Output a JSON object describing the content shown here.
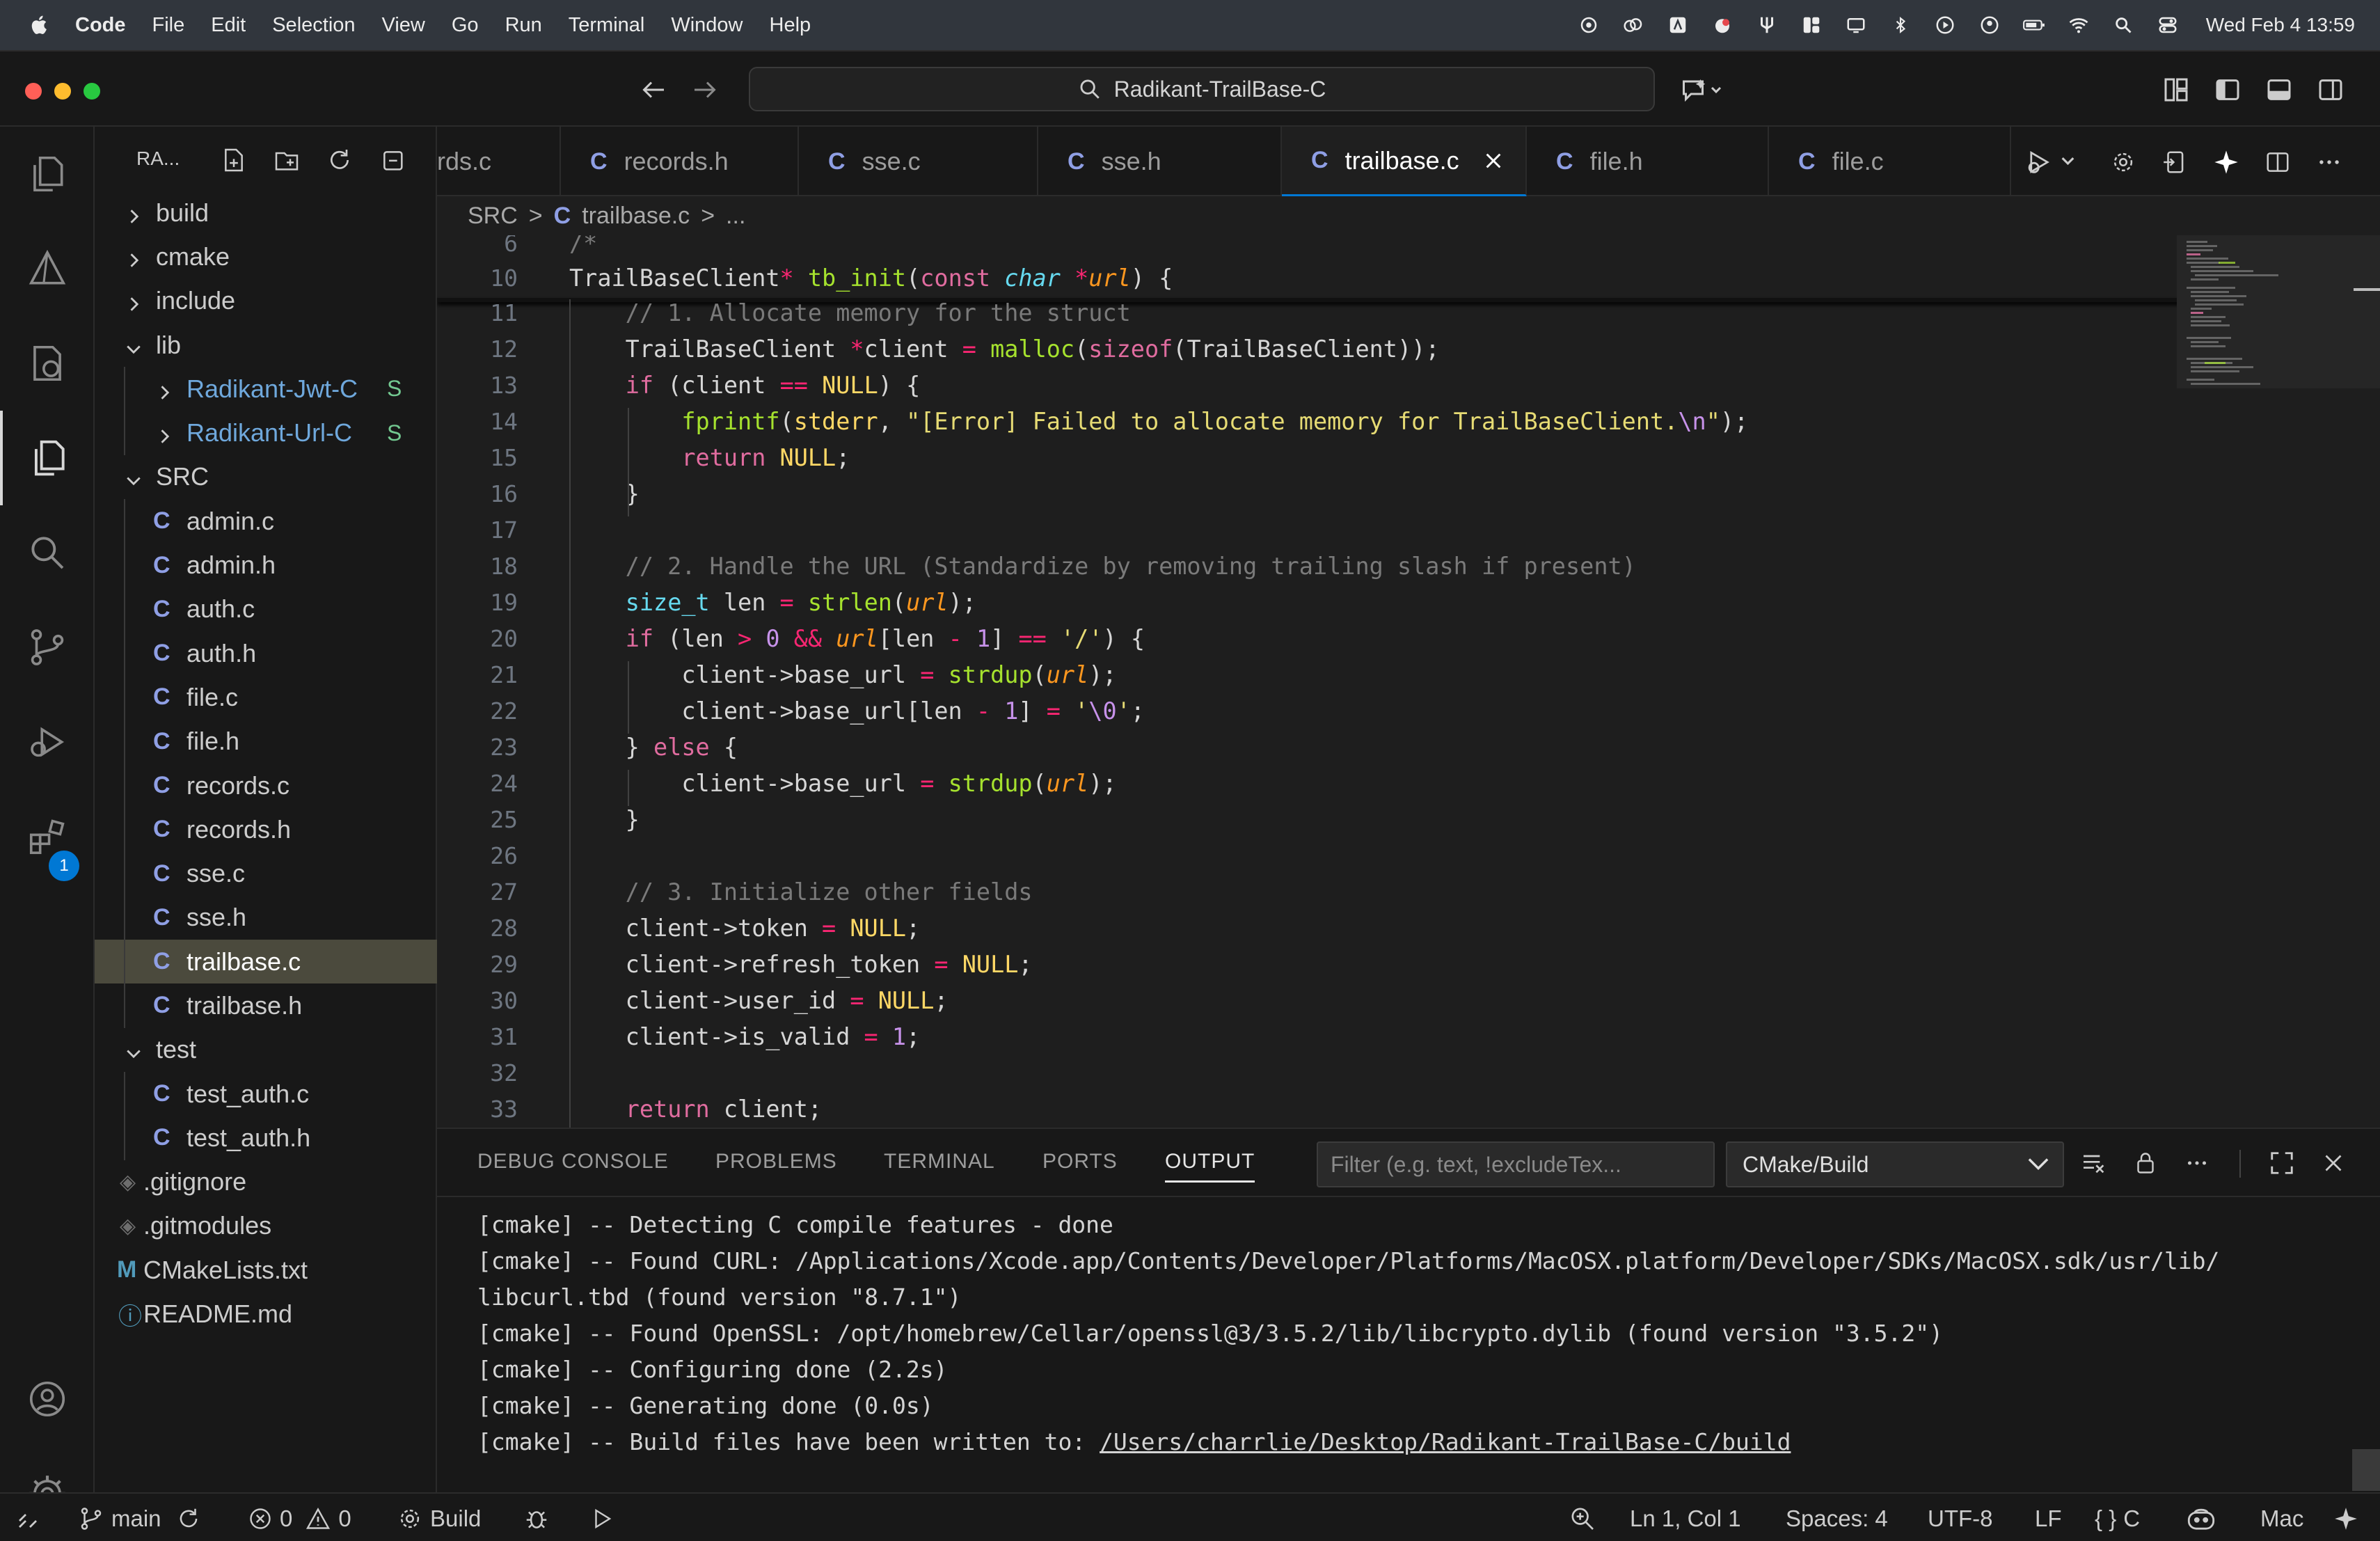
{
  "menubar": {
    "app": "Code",
    "items": [
      "File",
      "Edit",
      "Selection",
      "View",
      "Go",
      "Run",
      "Terminal",
      "Window",
      "Help"
    ],
    "clock": "Wed Feb 4  13:59"
  },
  "titlebar": {
    "search_text": "Radikant-TrailBase-C"
  },
  "sidebar": {
    "header": "RA...",
    "tree": [
      {
        "label": "build",
        "kind": "folder",
        "open": false,
        "depth": 0
      },
      {
        "label": "cmake",
        "kind": "folder",
        "open": false,
        "depth": 0
      },
      {
        "label": "include",
        "kind": "folder",
        "open": false,
        "depth": 0
      },
      {
        "label": "lib",
        "kind": "folder",
        "open": true,
        "depth": 0
      },
      {
        "label": "Radikant-Jwt-C",
        "kind": "submodule",
        "open": false,
        "depth": 1,
        "status": "S"
      },
      {
        "label": "Radikant-Url-C",
        "kind": "submodule",
        "open": false,
        "depth": 1,
        "status": "S"
      },
      {
        "label": "SRC",
        "kind": "folder",
        "open": true,
        "depth": 0
      },
      {
        "label": "admin.c",
        "kind": "c",
        "depth": 1
      },
      {
        "label": "admin.h",
        "kind": "c",
        "depth": 1
      },
      {
        "label": "auth.c",
        "kind": "c",
        "depth": 1
      },
      {
        "label": "auth.h",
        "kind": "c",
        "depth": 1
      },
      {
        "label": "file.c",
        "kind": "c",
        "depth": 1
      },
      {
        "label": "file.h",
        "kind": "c",
        "depth": 1
      },
      {
        "label": "records.c",
        "kind": "c",
        "depth": 1
      },
      {
        "label": "records.h",
        "kind": "c",
        "depth": 1
      },
      {
        "label": "sse.c",
        "kind": "c",
        "depth": 1
      },
      {
        "label": "sse.h",
        "kind": "c",
        "depth": 1
      },
      {
        "label": "trailbase.c",
        "kind": "c",
        "depth": 1,
        "selected": true
      },
      {
        "label": "trailbase.h",
        "kind": "c",
        "depth": 1
      },
      {
        "label": "test",
        "kind": "folder",
        "open": true,
        "depth": 0
      },
      {
        "label": "test_auth.c",
        "kind": "c",
        "depth": 1
      },
      {
        "label": "test_auth.h",
        "kind": "c",
        "depth": 1
      },
      {
        "label": ".gitignore",
        "kind": "git",
        "depth": 0
      },
      {
        "label": ".gitmodules",
        "kind": "git",
        "depth": 0
      },
      {
        "label": "CMakeLists.txt",
        "kind": "cmake",
        "depth": 0
      },
      {
        "label": "README.md",
        "kind": "info",
        "depth": 0
      }
    ]
  },
  "activitybar": {
    "extensions_badge": "1"
  },
  "tabs": [
    {
      "label": "rds.c",
      "icon": false
    },
    {
      "label": "records.h",
      "icon": true
    },
    {
      "label": "sse.c",
      "icon": true
    },
    {
      "label": "sse.h",
      "icon": true
    },
    {
      "label": "trailbase.c",
      "icon": true,
      "active": true
    },
    {
      "label": "file.h",
      "icon": true
    },
    {
      "label": "file.c",
      "icon": true
    }
  ],
  "breadcrumb": {
    "folder": "SRC",
    "sep": ">",
    "file": "trailbase.c",
    "more": "..."
  },
  "code": {
    "sticky": [
      {
        "num": "6",
        "text": "/*"
      },
      {
        "num": "10",
        "text": "TrailBaseClient* tb_init(const char *url) {"
      }
    ],
    "lines": [
      {
        "num": "11",
        "text": "    // 1. Allocate memory for the struct"
      },
      {
        "num": "12",
        "text": "    TrailBaseClient *client = malloc(sizeof(TrailBaseClient));"
      },
      {
        "num": "13",
        "text": "    if (client == NULL) {"
      },
      {
        "num": "14",
        "text": "        fprintf(stderr, \"[Error] Failed to allocate memory for TrailBaseClient.\\n\");"
      },
      {
        "num": "15",
        "text": "        return NULL;"
      },
      {
        "num": "16",
        "text": "    }"
      },
      {
        "num": "17",
        "text": ""
      },
      {
        "num": "18",
        "text": "    // 2. Handle the URL (Standardize by removing trailing slash if present)"
      },
      {
        "num": "19",
        "text": "    size_t len = strlen(url);"
      },
      {
        "num": "20",
        "text": "    if (len > 0 && url[len - 1] == '/') {"
      },
      {
        "num": "21",
        "text": "        client->base_url = strdup(url);"
      },
      {
        "num": "22",
        "text": "        client->base_url[len - 1] = '\\0';"
      },
      {
        "num": "23",
        "text": "    } else {"
      },
      {
        "num": "24",
        "text": "        client->base_url = strdup(url);"
      },
      {
        "num": "25",
        "text": "    }"
      },
      {
        "num": "26",
        "text": ""
      },
      {
        "num": "27",
        "text": "    // 3. Initialize other fields"
      },
      {
        "num": "28",
        "text": "    client->token = NULL;"
      },
      {
        "num": "29",
        "text": "    client->refresh_token = NULL;"
      },
      {
        "num": "30",
        "text": "    client->user_id = NULL;"
      },
      {
        "num": "31",
        "text": "    client->is_valid = 1;"
      },
      {
        "num": "32",
        "text": ""
      },
      {
        "num": "33",
        "text": "    return client;"
      }
    ]
  },
  "panel": {
    "tabs": [
      "DEBUG CONSOLE",
      "PROBLEMS",
      "TERMINAL",
      "PORTS",
      "OUTPUT"
    ],
    "active_tab": "OUTPUT",
    "filter_placeholder": "Filter (e.g. text, !excludeTex...",
    "channel": "CMake/Build",
    "output": [
      "[cmake] -- Detecting C compile features - done",
      "[cmake] -- Found CURL: /Applications/Xcode.app/Contents/Developer/Platforms/MacOSX.platform/Developer/SDKs/MacOSX.sdk/usr/lib/",
      "libcurl.tbd (found version \"8.7.1\")",
      "[cmake] -- Found OpenSSL: /opt/homebrew/Cellar/openssl@3/3.5.2/lib/libcrypto.dylib (found version \"3.5.2\")",
      "[cmake] -- Configuring done (2.2s)",
      "[cmake] -- Generating done (0.0s)"
    ],
    "last_prefix": "[cmake] -- Build files have been written to: ",
    "last_link": "/Users/charrlie/Desktop/Radikant-TrailBase-C/build"
  },
  "statusbar": {
    "branch": "main",
    "errors": "0",
    "warnings": "0",
    "build": "Build",
    "cursor": "Ln 1, Col 1",
    "spaces": "Spaces: 4",
    "encoding": "UTF-8",
    "eol": "LF",
    "language": "C",
    "platform": "Mac"
  },
  "colors": {
    "accent": "#0078d4",
    "selection": "#4b4a3d",
    "c_file_icon": "#8f9fe5",
    "submodule": "#73c991"
  },
  "icons": [
    "apple-icon",
    "explorer-icon",
    "search-icon",
    "source-control-icon",
    "run-debug-icon",
    "extensions-icon",
    "account-icon",
    "gear-icon"
  ]
}
